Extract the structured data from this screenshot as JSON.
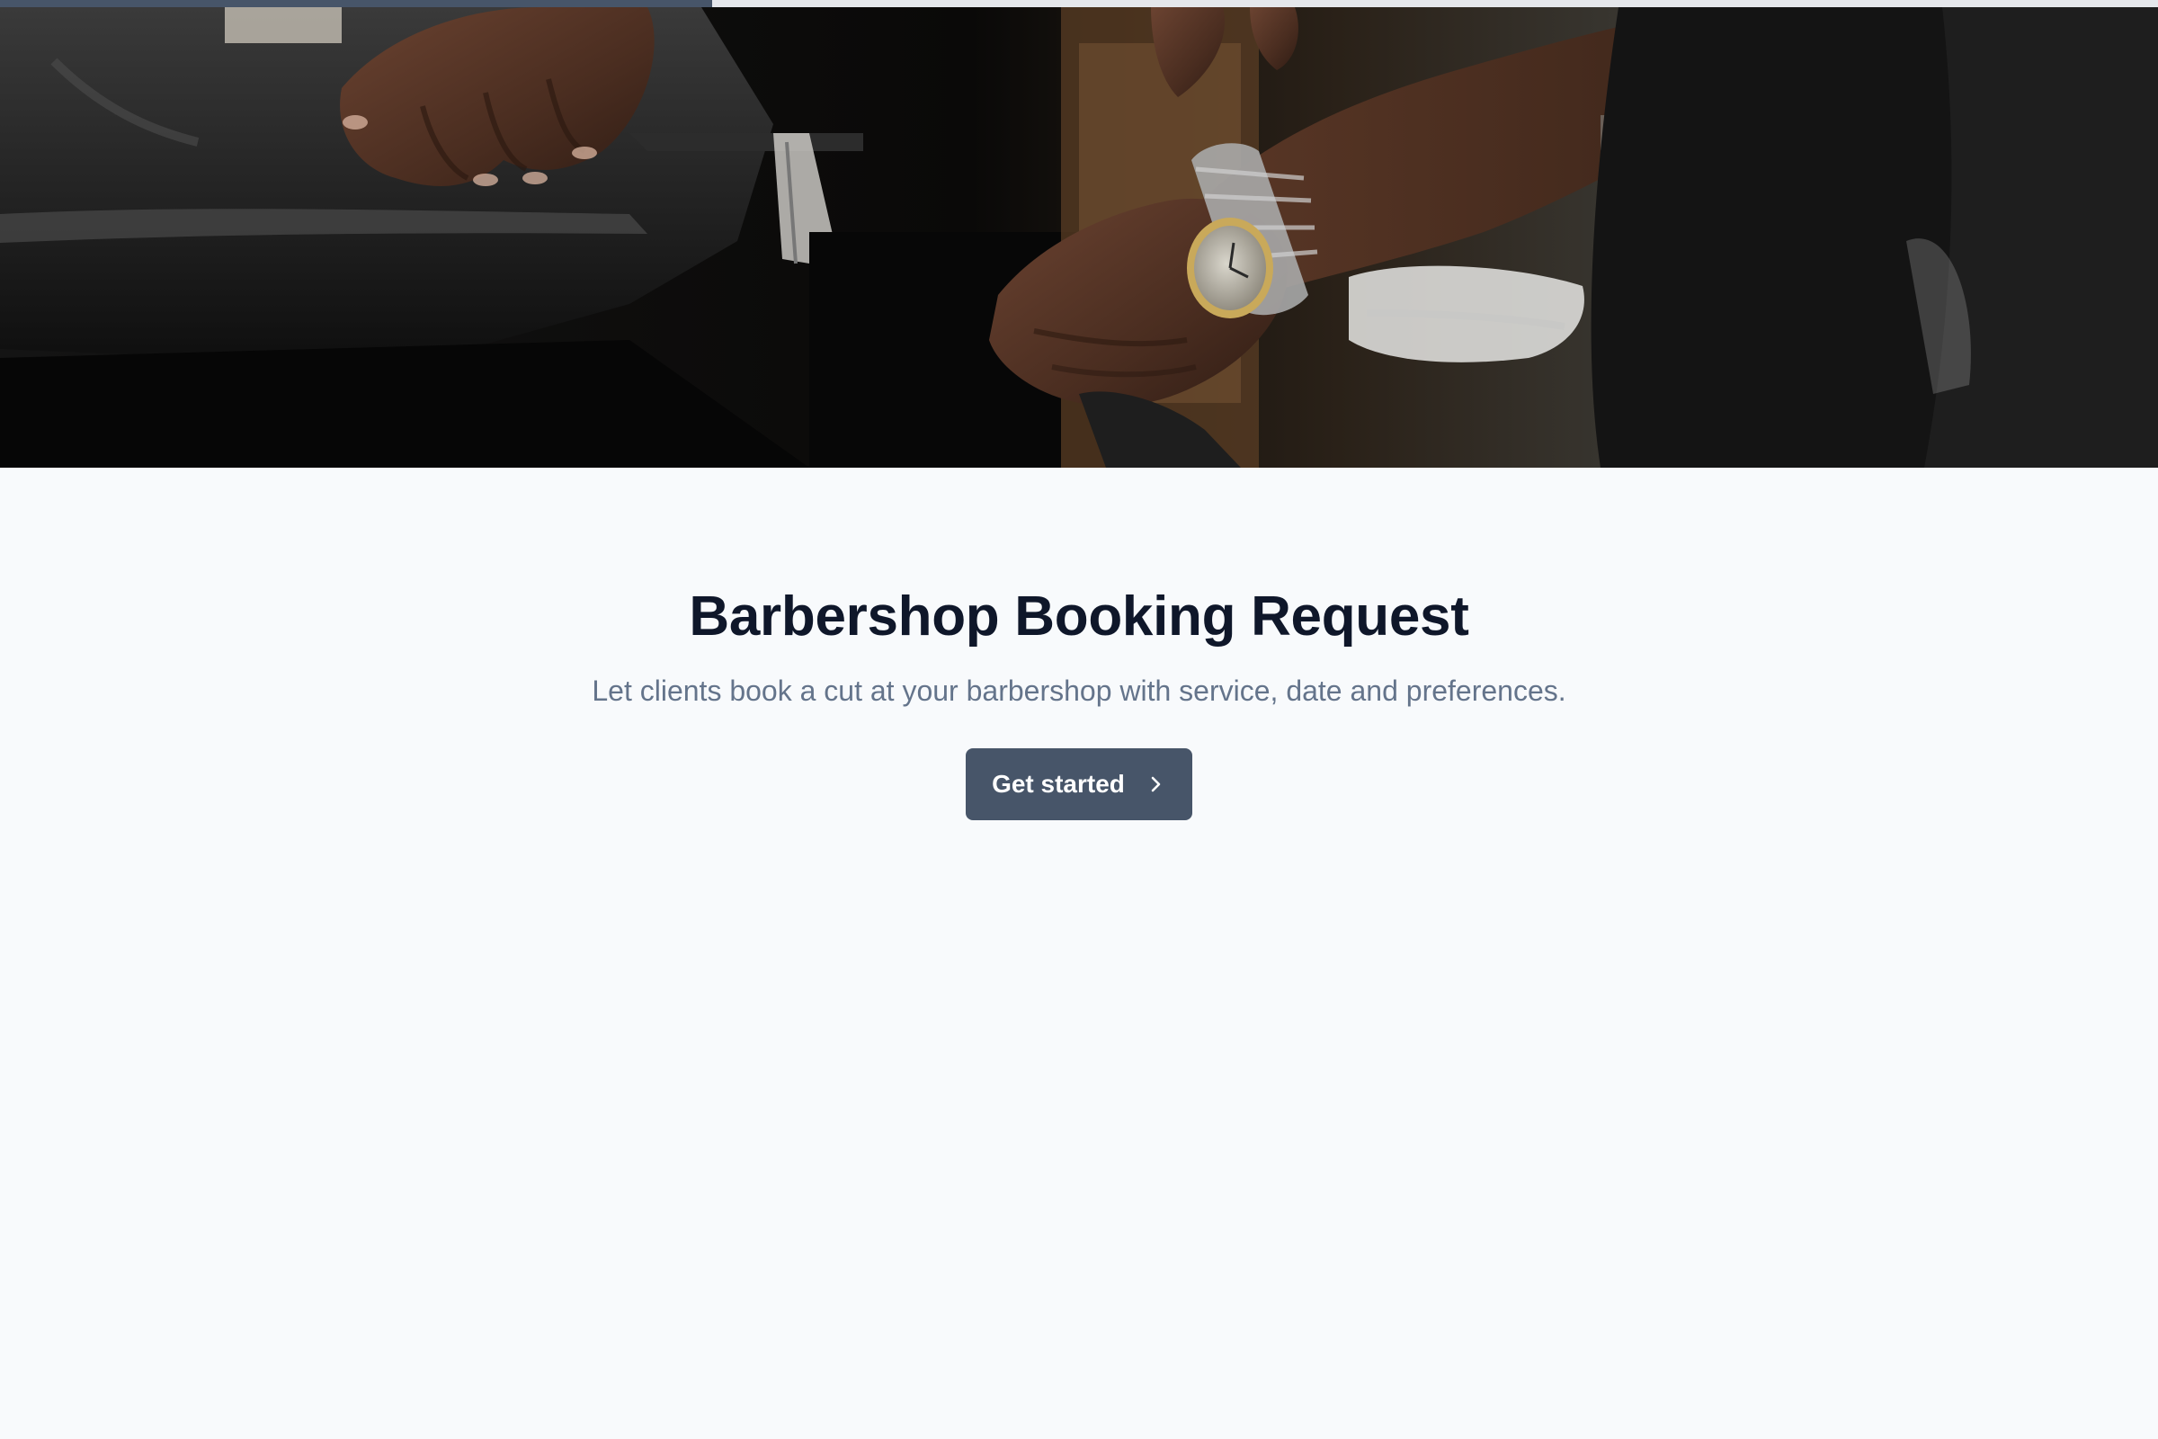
{
  "progress": {
    "value_fraction": 0.33,
    "color": "#475569"
  },
  "hero": {
    "image_description_icon": "barbershop-photo",
    "watch_icon": "wristwatch-icon"
  },
  "main": {
    "title": "Barbershop Booking Request",
    "subtitle": "Let clients book a cut at your barbershop with service, date and preferences.",
    "cta_label": "Get started",
    "cta_icon": "chevron-right-icon"
  },
  "colors": {
    "background": "#f8fafc",
    "title": "#0f172a",
    "subtitle": "#64748b",
    "button": "#475569",
    "button_text": "#ffffff"
  }
}
